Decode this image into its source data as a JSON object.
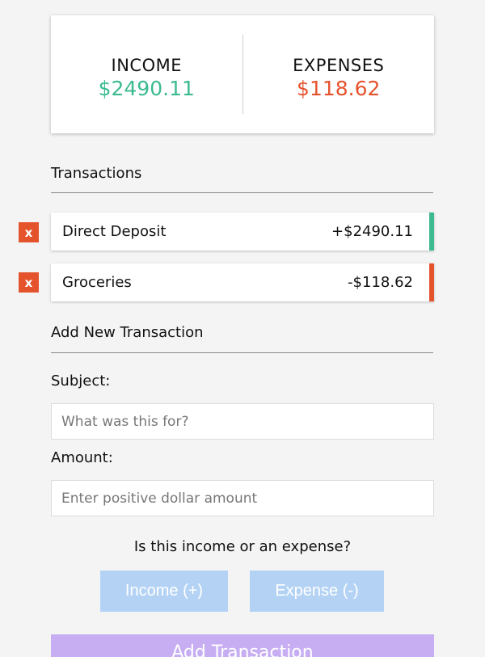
{
  "summary": {
    "income_label": "INCOME",
    "income_value": "$2490.11",
    "expenses_label": "EXPENSES",
    "expenses_value": "$118.62"
  },
  "transactions": {
    "title": "Transactions",
    "items": [
      {
        "name": "Direct Deposit",
        "amount": "+$2490.11",
        "kind": "income",
        "delete_label": "x"
      },
      {
        "name": "Groceries",
        "amount": "-$118.62",
        "kind": "expense",
        "delete_label": "x"
      }
    ]
  },
  "form": {
    "title": "Add New Transaction",
    "subject_label": "Subject:",
    "subject_placeholder": "What was this for?",
    "amount_label": "Amount:",
    "amount_placeholder": "Enter positive dollar amount",
    "question": "Is this income or an expense?",
    "income_button": "Income (+)",
    "expense_button": "Expense (-)",
    "submit_button": "Add Transaction"
  },
  "colors": {
    "income": "#3cba92",
    "expense": "#e5532d",
    "type_button": "#b4d3f4",
    "submit_button": "#c7aef3"
  }
}
